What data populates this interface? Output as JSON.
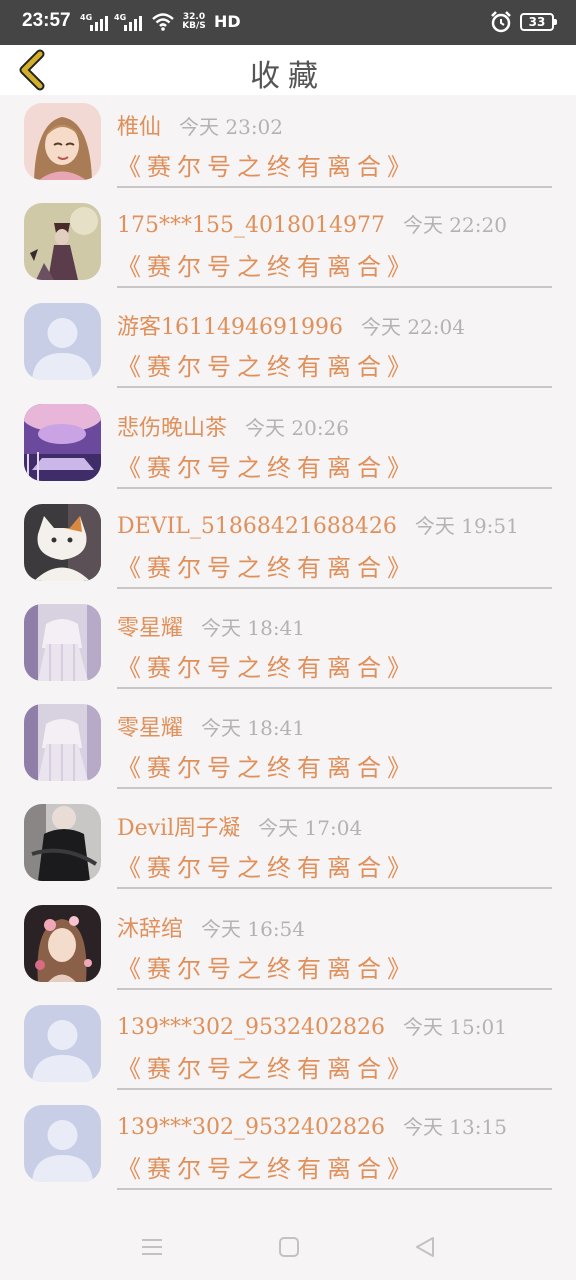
{
  "status_bar": {
    "time": "23:57",
    "net1": "4G",
    "net2": "4G",
    "speed_value": "32.0",
    "speed_unit": "KB/S",
    "hd": "HD",
    "battery": "33"
  },
  "header": {
    "title": "收藏"
  },
  "favorites": [
    {
      "user": "椎仙",
      "time": "今天 23:02",
      "book": "《赛尔号之终有离合》",
      "avatar": "anime-girl-avatar"
    },
    {
      "user": "175***155_4018014977",
      "time": "今天 22:20",
      "book": "《赛尔号之终有离合》",
      "avatar": "dark-figure-avatar"
    },
    {
      "user": "游客1611494691996",
      "time": "今天 22:04",
      "book": "《赛尔号之终有离合》",
      "avatar": "default-avatar"
    },
    {
      "user": "悲伤晚山茶",
      "time": "今天 20:26",
      "book": "《赛尔号之终有离合》",
      "avatar": "purple-scene-avatar"
    },
    {
      "user": "DEVIL_51868421688426",
      "time": "今天 19:51",
      "book": "《赛尔号之终有离合》",
      "avatar": "cat-avatar"
    },
    {
      "user": "零星耀",
      "time": "今天 18:41",
      "book": "《赛尔号之终有离合》",
      "avatar": "white-dress-avatar"
    },
    {
      "user": "零星耀",
      "time": "今天 18:41",
      "book": "《赛尔号之终有离合》",
      "avatar": "white-dress-avatar"
    },
    {
      "user": "Devil周子凝",
      "time": "今天 17:04",
      "book": "《赛尔号之终有离合》",
      "avatar": "black-dress-avatar"
    },
    {
      "user": "沐辞绾",
      "time": "今天 16:54",
      "book": "《赛尔号之终有离合》",
      "avatar": "flower-girl-avatar"
    },
    {
      "user": "139***302_9532402826",
      "time": "今天 15:01",
      "book": "《赛尔号之终有离合》",
      "avatar": "default-avatar"
    },
    {
      "user": "139***302_9532402826",
      "time": "今天 13:15",
      "book": "《赛尔号之终有离合》",
      "avatar": "default-avatar"
    }
  ],
  "nav": {
    "menu_icon": "menu-icon",
    "home_icon": "home-icon",
    "back_icon": "back-triangle-icon"
  },
  "colors": {
    "accent": "#e0905a",
    "muted": "#b3b3b3",
    "back_arrow": "#d4b02a"
  }
}
